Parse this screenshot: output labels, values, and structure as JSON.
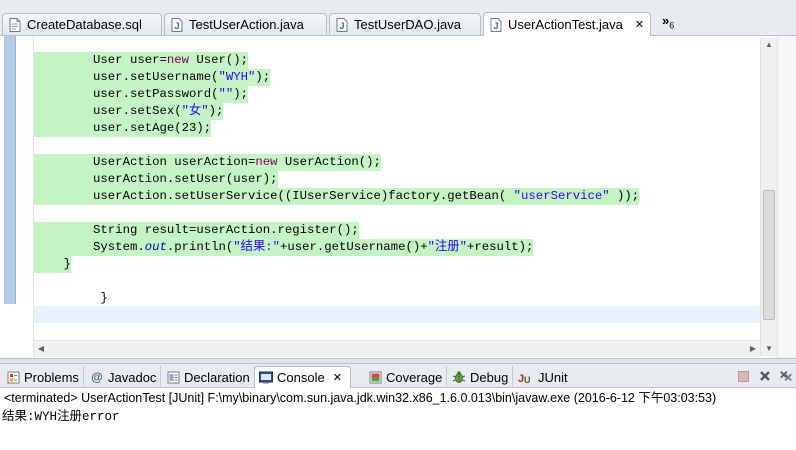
{
  "editor_tabs": [
    {
      "label": "CreateDatabase.sql",
      "icon": "sql-file-icon"
    },
    {
      "label": "TestUserAction.java",
      "icon": "java-file-icon"
    },
    {
      "label": "TestUserDAO.java",
      "icon": "java-file-icon"
    },
    {
      "label": "UserActionTest.java",
      "icon": "java-file-icon",
      "active": true
    }
  ],
  "overflow": {
    "symbol": "»",
    "count": "6"
  },
  "code": {
    "l1": {
      "indent": "        ",
      "a": "User user=",
      "kw": "new",
      "b": " User();"
    },
    "l2": {
      "indent": "        ",
      "a": "user.setUsername(",
      "str": "\"WYH\"",
      "b": ");"
    },
    "l3": {
      "indent": "        ",
      "a": "user.setPassword(",
      "str": "\"\"",
      "b": ");"
    },
    "l4": {
      "indent": "        ",
      "a": "user.setSex(",
      "str": "\"女\"",
      "b": ");"
    },
    "l5": {
      "indent": "        ",
      "a": "user.setAge(23);"
    },
    "l6": {
      "indent": "        ",
      "a": "UserAction userAction=",
      "kw": "new",
      "b": " UserAction();"
    },
    "l7": {
      "indent": "        ",
      "a": "userAction.setUser(user);"
    },
    "l8": {
      "indent": "        ",
      "a": "userAction.setUserService((IUserService)factory.getBean( ",
      "str": "\"userService\"",
      "b": " ));"
    },
    "l9": {
      "indent": "        ",
      "a": "String result=userAction.register();"
    },
    "l10": {
      "indent": "        ",
      "a": "System.",
      "fld": "out",
      "b": ".println(",
      "str1": "\"结果:\"",
      "c": "+user.getUsername()+",
      "str2": "\"注册\"",
      "d": "+result);"
    },
    "l11": {
      "indent": "    ",
      "a": "}"
    },
    "l12": {
      "indent": "         ",
      "a": "}"
    }
  },
  "view_tabs": [
    {
      "label": "Problems",
      "icon": "problems-icon"
    },
    {
      "label": "Javadoc",
      "icon": "javadoc-icon"
    },
    {
      "label": "Declaration",
      "icon": "declaration-icon"
    },
    {
      "label": "Console",
      "icon": "console-icon",
      "active": true,
      "close": "✕"
    },
    {
      "label": "Coverage",
      "icon": "coverage-icon"
    },
    {
      "label": "Debug",
      "icon": "debug-icon"
    },
    {
      "label": "JUnit",
      "icon": "junit-icon"
    }
  ],
  "console": {
    "status": "<terminated> UserActionTest [JUnit] F:\\my\\binary\\com.sun.java.jdk.win32.x86_1.6.0.013\\bin\\javaw.exe (2016-6-12 下午03:03:53)",
    "output": "结果:WYH注册error"
  },
  "colors": {
    "keyword": "#7f0055",
    "string": "#2a00ff",
    "field": "#0000c0",
    "highlight": "#c4f3c4"
  }
}
